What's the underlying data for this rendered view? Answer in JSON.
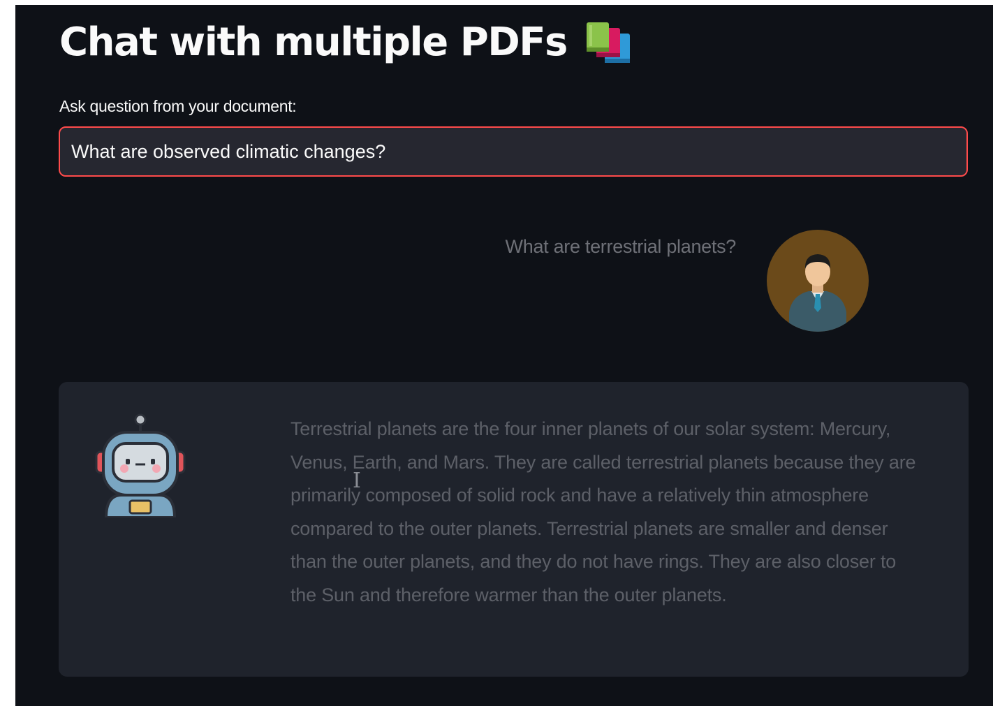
{
  "header": {
    "title": "Chat with multiple PDFs",
    "title_icon": "books-icon"
  },
  "question": {
    "label": "Ask question from your document:",
    "value": "What are observed climatic changes?",
    "border_color": "#ff4b4b"
  },
  "messages": [
    {
      "role": "user",
      "avatar_icon": "businessman-avatar-icon",
      "text": "What are terrestrial planets?"
    },
    {
      "role": "bot",
      "avatar_icon": "robot-avatar-icon",
      "text": "Terrestrial planets are the four inner planets of our solar system: Mercury, Venus, Earth, and Mars. They are called terrestrial planets because they are primarily composed of solid rock and have a relatively thin atmosphere compared to the outer planets. Terrestrial planets are smaller and denser than the outer planets, and they do not have rings. They are also closer to the Sun and therefore warmer than the outer planets."
    }
  ],
  "cursor_icon": "text-cursor-icon",
  "colors": {
    "background": "#0e1117",
    "input_bg": "#262730",
    "bot_bubble_bg": "#1f232c",
    "user_avatar_bg": "#6b4a1a",
    "text_primary": "#fafafa",
    "text_muted": "#6e7077"
  }
}
